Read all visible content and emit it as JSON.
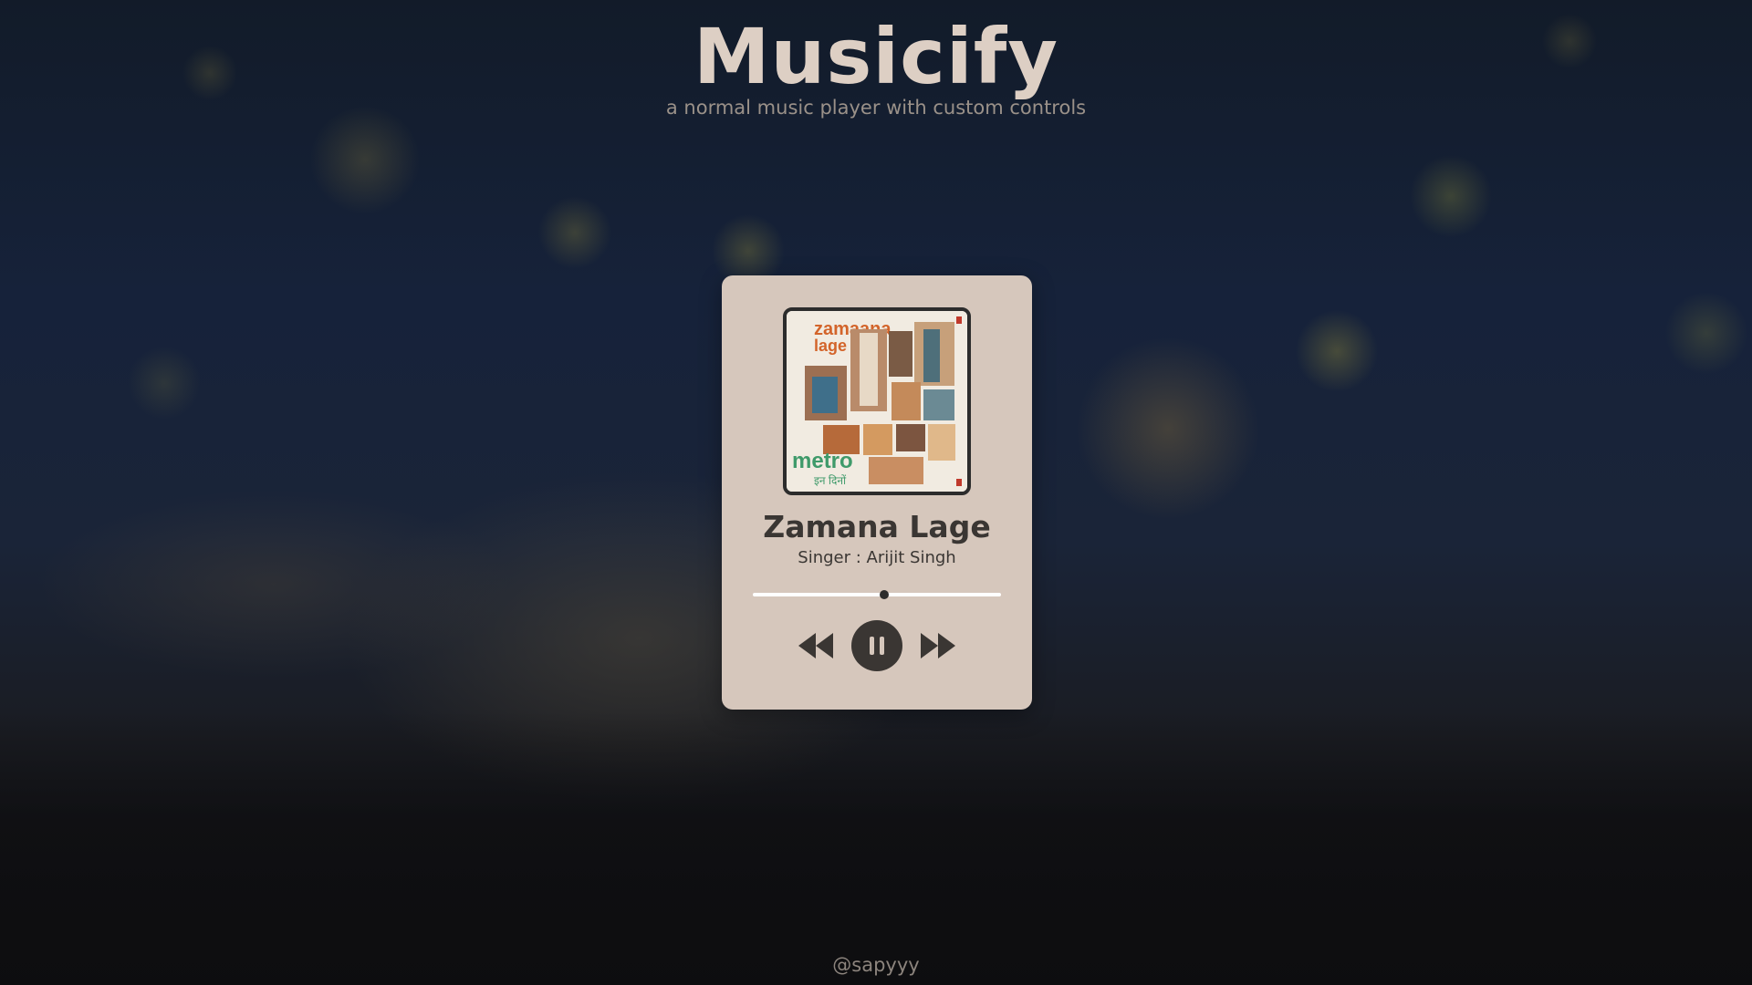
{
  "app": {
    "title": "Musicify",
    "subtitle": "a normal music player with custom controls"
  },
  "player": {
    "song_title": "Zamana Lage",
    "singer": "Singer : Arijit Singh",
    "progress_fraction": 0.53,
    "state": "playing",
    "cover_text": {
      "title_line1": "zamaana",
      "title_line2": "lage",
      "film": "metro",
      "film_sub": "इन दिनों"
    },
    "controls": {
      "prev_icon": "rewind-icon",
      "play_icon": "pause-icon",
      "next_icon": "fast-forward-icon"
    }
  },
  "footer": {
    "credit": "@sapyyy"
  },
  "colors": {
    "card_bg": "#d6c7bc",
    "title": "#ddcfc4",
    "button_dark": "#3a3633"
  }
}
